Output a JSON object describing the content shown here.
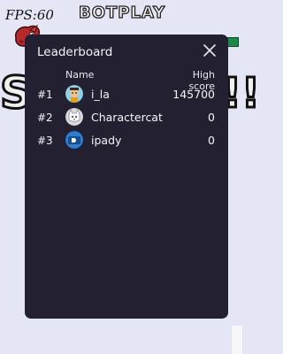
{
  "hud": {
    "fps_label": "FPS:60",
    "botplay_label": "BOTPLAY",
    "big_text_left": "S",
    "big_text_right": "!!"
  },
  "leaderboard": {
    "title": "Leaderboard",
    "columns": {
      "name": "Name",
      "score": "High score"
    },
    "rows": [
      {
        "rank": "#1",
        "name": "i_la",
        "score": "145700",
        "avatar": "cartoon-character-avatar"
      },
      {
        "rank": "#2",
        "name": "Charactercat",
        "score": "0",
        "avatar": "cat-avatar"
      },
      {
        "rank": "#3",
        "name": "ipady",
        "score": "0",
        "avatar": "blue-logo-avatar"
      }
    ]
  },
  "colors": {
    "modal_bg": "#232032",
    "page_bg": "#e4e6f6",
    "text": "#f4f4f4"
  }
}
